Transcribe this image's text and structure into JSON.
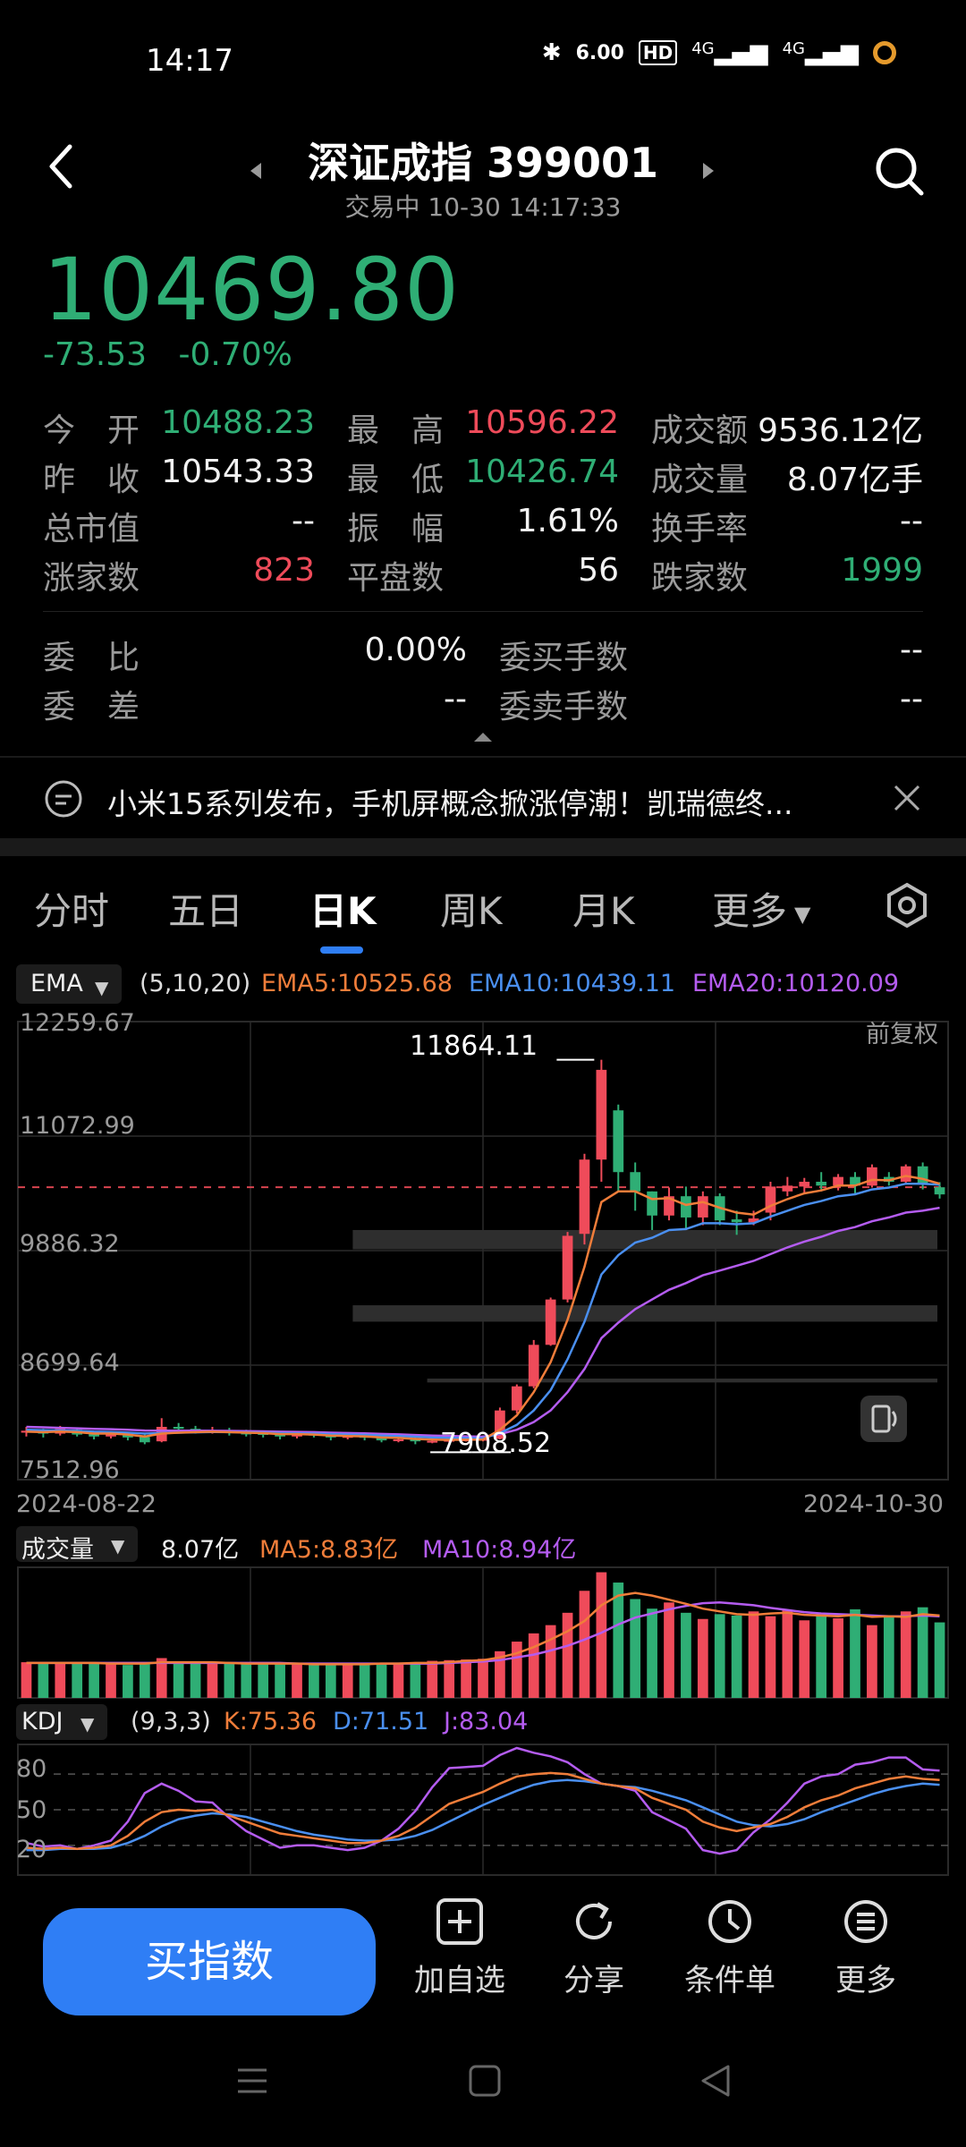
{
  "status": {
    "time": "14:17",
    "net_speed": "6.00",
    "hd": "HD",
    "sig1": "4G",
    "sig2": "4G"
  },
  "header": {
    "title": "深证成指 399001",
    "subtitle": "交易中 10-30 14:17:33",
    "price": "10469.80",
    "change": "-73.53",
    "change_pct": "-0.70%"
  },
  "stats": {
    "open_label": "今　开",
    "open": "10488.23",
    "high_label": "最　高",
    "high": "10596.22",
    "amount_label": "成交额",
    "amount": "9536.12亿",
    "prev_label": "昨　收",
    "prev": "10543.33",
    "low_label": "最　低",
    "low": "10426.74",
    "volume_label": "成交量",
    "volume": "8.07亿手",
    "mcap_label": "总市值",
    "mcap": "--",
    "amp_label": "振　幅",
    "amp": "1.61%",
    "turnover_label": "换手率",
    "turnover": "--",
    "up_label": "涨家数",
    "up": "823",
    "flat_label": "平盘数",
    "flat": "56",
    "down_label": "跌家数",
    "down": "1999",
    "wb_label": "委　比",
    "wb": "0.00%",
    "wc_label": "委　差",
    "wc": "--",
    "buy_hands_label": "委买手数",
    "buy_hands": "--",
    "sell_hands_label": "委卖手数",
    "sell_hands": "--"
  },
  "news": {
    "text": "小米15系列发布，手机屏概念掀涨停潮！凯瑞德终..."
  },
  "tabs": [
    "分时",
    "五日",
    "日K",
    "周K",
    "月K",
    "更多"
  ],
  "active_tab": "日K",
  "chart_data": {
    "type": "candlestick",
    "indicator": "EMA",
    "indicator_params": "(5,10,20)",
    "ema5": "EMA5:10525.68",
    "ema10": "EMA10:10439.11",
    "ema20": "EMA20:10120.09",
    "adjust": "前复权",
    "y_ticks": [
      "12259.67",
      "11072.99",
      "9886.32",
      "8699.64",
      "7512.96"
    ],
    "ylim": [
      7512.96,
      12259.67
    ],
    "x_start": "2024-08-22",
    "x_end": "2024-10-30",
    "max_label": "11864.11",
    "min_label": "7908.52",
    "candles": [
      [
        8000,
        8020,
        7960,
        8060
      ],
      [
        8010,
        7990,
        7950,
        8040
      ],
      [
        7990,
        8040,
        7970,
        8070
      ],
      [
        8030,
        7980,
        7960,
        8050
      ],
      [
        7985,
        7960,
        7930,
        8000
      ],
      [
        7960,
        7990,
        7940,
        8010
      ],
      [
        7990,
        7950,
        7920,
        8000
      ],
      [
        7955,
        7900,
        7880,
        7980
      ],
      [
        7910,
        8060,
        7900,
        8150
      ],
      [
        8060,
        8040,
        7990,
        8100
      ],
      [
        8040,
        8010,
        7990,
        8070
      ],
      [
        8010,
        8020,
        7990,
        8060
      ],
      [
        8020,
        8000,
        7970,
        8050
      ],
      [
        8000,
        7995,
        7960,
        8030
      ],
      [
        7995,
        7985,
        7950,
        8020
      ],
      [
        7985,
        7960,
        7930,
        8000
      ],
      [
        7960,
        7990,
        7940,
        8010
      ],
      [
        7990,
        7970,
        7950,
        8010
      ],
      [
        7970,
        7950,
        7920,
        7990
      ],
      [
        7950,
        7965,
        7930,
        7990
      ],
      [
        7965,
        7950,
        7920,
        7980
      ],
      [
        7950,
        7920,
        7900,
        7970
      ],
      [
        7920,
        7930,
        7900,
        7960
      ],
      [
        7930,
        7910,
        7880,
        7950
      ],
      [
        7910,
        7915,
        7890,
        7940
      ],
      [
        7915,
        7925,
        7900,
        7950
      ],
      [
        7925,
        7930,
        7908,
        7960
      ],
      [
        7930,
        7935,
        7910,
        7960
      ],
      [
        7935,
        8230,
        7930,
        8260
      ],
      [
        8230,
        8480,
        8200,
        8500
      ],
      [
        8480,
        8910,
        8460,
        8960
      ],
      [
        8910,
        9380,
        8900,
        9400
      ],
      [
        9380,
        10040,
        9350,
        10080
      ],
      [
        10060,
        10830,
        9950,
        10890
      ],
      [
        10830,
        11760,
        10600,
        11864
      ],
      [
        11340,
        10700,
        10500,
        11400
      ],
      [
        10700,
        10500,
        10300,
        10800
      ],
      [
        10500,
        10250,
        10100,
        10500
      ],
      [
        10250,
        10450,
        10200,
        10540
      ],
      [
        10450,
        10230,
        10100,
        10550
      ],
      [
        10230,
        10450,
        10150,
        10500
      ],
      [
        10450,
        10200,
        10150,
        10480
      ],
      [
        10210,
        10180,
        10050,
        10300
      ],
      [
        10180,
        10220,
        10150,
        10300
      ],
      [
        10280,
        10550,
        10200,
        10600
      ],
      [
        10500,
        10560,
        10450,
        10650
      ],
      [
        10550,
        10600,
        10480,
        10640
      ],
      [
        10600,
        10560,
        10500,
        10700
      ],
      [
        10560,
        10650,
        10510,
        10680
      ],
      [
        10650,
        10560,
        10480,
        10700
      ],
      [
        10560,
        10750,
        10540,
        10780
      ],
      [
        10650,
        10600,
        10560,
        10700
      ],
      [
        10600,
        10760,
        10570,
        10780
      ],
      [
        10760,
        10580,
        10520,
        10800
      ],
      [
        10543,
        10469,
        10426,
        10596
      ]
    ],
    "ema5_vals": [
      8010,
      8005,
      8012,
      8005,
      7990,
      7990,
      7980,
      7960,
      7990,
      8000,
      8005,
      8010,
      8005,
      8000,
      7995,
      7985,
      7985,
      7980,
      7970,
      7965,
      7962,
      7950,
      7945,
      7935,
      7928,
      7925,
      7926,
      7928,
      8030,
      8180,
      8420,
      8730,
      9170,
      9720,
      10390,
      10500,
      10500,
      10420,
      10430,
      10360,
      10390,
      10330,
      10280,
      10260,
      10350,
      10420,
      10480,
      10510,
      10560,
      10560,
      10620,
      10615,
      10660,
      10630,
      10580
    ],
    "ema10_vals": [
      8030,
      8025,
      8022,
      8018,
      8010,
      8007,
      8000,
      7990,
      7995,
      8000,
      8003,
      8006,
      8005,
      8003,
      8000,
      7995,
      7993,
      7990,
      7985,
      7980,
      7977,
      7970,
      7965,
      7958,
      7950,
      7946,
      7944,
      7942,
      7995,
      8080,
      8230,
      8440,
      8760,
      9150,
      9640,
      9840,
      9970,
      10020,
      10100,
      10110,
      10170,
      10170,
      10160,
      10170,
      10240,
      10300,
      10360,
      10400,
      10450,
      10470,
      10520,
      10540,
      10580,
      10580,
      10570
    ],
    "ema20_vals": [
      8060,
      8055,
      8050,
      8045,
      8040,
      8036,
      8030,
      8022,
      8020,
      8020,
      8020,
      8019,
      8018,
      8016,
      8014,
      8010,
      8008,
      8005,
      8000,
      7996,
      7993,
      7987,
      7982,
      7976,
      7970,
      7966,
      7962,
      7958,
      7985,
      8030,
      8110,
      8230,
      8420,
      8660,
      8980,
      9140,
      9280,
      9380,
      9480,
      9550,
      9630,
      9680,
      9730,
      9780,
      9850,
      9920,
      9980,
      10030,
      10090,
      10130,
      10190,
      10230,
      10280,
      10300,
      10330
    ]
  },
  "volume": {
    "label": "成交量",
    "current": "8.07亿",
    "ma5": "MA5:8.83亿",
    "ma10": "MA10:8.94亿",
    "bars": [
      5.2,
      5.0,
      5.1,
      5.0,
      5.2,
      4.9,
      4.8,
      5.1,
      5.8,
      5.3,
      5.2,
      5.0,
      5.1,
      5.0,
      5.0,
      4.9,
      5.0,
      4.9,
      4.8,
      4.9,
      5.0,
      5.0,
      5.1,
      5.2,
      5.4,
      5.5,
      5.6,
      5.7,
      6.8,
      8.2,
      9.4,
      10.6,
      12.4,
      15.6,
      18.3,
      16.8,
      14.4,
      13.0,
      13.9,
      12.4,
      11.5,
      12.2,
      12.0,
      12.6,
      11.9,
      12.8,
      11.3,
      12.1,
      11.6,
      12.9,
      10.6,
      11.9,
      12.6,
      13.2,
      11.0
    ],
    "ma5_vals": [
      5.1,
      5.1,
      5.1,
      5.1,
      5.1,
      5.0,
      5.0,
      5.0,
      5.2,
      5.2,
      5.2,
      5.2,
      5.1,
      5.0,
      5.0,
      5.0,
      5.0,
      4.9,
      4.9,
      4.9,
      4.9,
      5.0,
      5.0,
      5.1,
      5.1,
      5.2,
      5.4,
      5.5,
      5.9,
      6.5,
      7.4,
      8.5,
      9.7,
      11.2,
      13.5,
      14.9,
      15.3,
      14.9,
      14.3,
      13.7,
      13.0,
      12.6,
      12.2,
      12.1,
      12.3,
      12.4,
      12.1,
      12.0,
      11.9,
      12.1,
      11.8,
      11.9,
      11.8,
      12.2,
      12.0
    ],
    "ma10_vals": [
      5.1,
      5.1,
      5.1,
      5.1,
      5.1,
      5.1,
      5.1,
      5.1,
      5.1,
      5.1,
      5.1,
      5.1,
      5.1,
      5.1,
      5.1,
      5.1,
      5.0,
      5.0,
      5.0,
      5.0,
      5.0,
      5.0,
      5.0,
      5.0,
      5.0,
      5.1,
      5.2,
      5.3,
      5.5,
      5.9,
      6.3,
      6.9,
      7.6,
      8.5,
      9.5,
      10.7,
      11.7,
      12.3,
      12.9,
      13.4,
      13.8,
      13.9,
      13.7,
      13.5,
      13.1,
      12.8,
      12.5,
      12.3,
      12.2,
      12.1,
      12.0,
      11.9,
      11.9,
      12.0,
      11.9
    ]
  },
  "kdj": {
    "label": "KDJ",
    "params": "(9,3,3)",
    "k": "K:75.36",
    "d": "D:71.51",
    "j": "J:83.04",
    "ticks": [
      "80",
      "50",
      "20"
    ],
    "k_vals": [
      18,
      17,
      18,
      17,
      18,
      20,
      28,
      40,
      48,
      50,
      49,
      50,
      45,
      40,
      35,
      30,
      28,
      26,
      24,
      22,
      22,
      24,
      28,
      35,
      45,
      55,
      60,
      65,
      72,
      78,
      80,
      81,
      80,
      76,
      72,
      70,
      68,
      60,
      55,
      50,
      40,
      35,
      32,
      35,
      38,
      44,
      52,
      58,
      62,
      68,
      72,
      76,
      78,
      76,
      75
    ],
    "d_vals": [
      16,
      16,
      17,
      17,
      17,
      18,
      22,
      28,
      36,
      42,
      45,
      47,
      46,
      44,
      40,
      36,
      32,
      29,
      27,
      25,
      24,
      24,
      25,
      28,
      33,
      40,
      47,
      54,
      60,
      66,
      71,
      74,
      75,
      74,
      72,
      70,
      69,
      66,
      62,
      58,
      52,
      46,
      40,
      37,
      36,
      38,
      42,
      48,
      53,
      58,
      63,
      67,
      70,
      72,
      71
    ],
    "j_vals": [
      22,
      19,
      20,
      17,
      20,
      24,
      40,
      64,
      72,
      66,
      57,
      56,
      43,
      32,
      25,
      18,
      20,
      20,
      18,
      16,
      18,
      24,
      34,
      49,
      69,
      85,
      86,
      87,
      96,
      102,
      98,
      95,
      90,
      80,
      72,
      70,
      66,
      48,
      41,
      34,
      16,
      13,
      16,
      31,
      42,
      56,
      72,
      78,
      80,
      88,
      90,
      94,
      94,
      84,
      83
    ]
  },
  "bottom": {
    "buy_label": "买指数",
    "add_label": "加自选",
    "share_label": "分享",
    "cond_label": "条件单",
    "more_label": "更多"
  },
  "colors": {
    "up": "#ef4b5a",
    "down": "#2fae75",
    "ema5": "#f07d3a",
    "ema10": "#4a8ff0",
    "ema20": "#b45cf0",
    "accent": "#2f7ef5"
  }
}
